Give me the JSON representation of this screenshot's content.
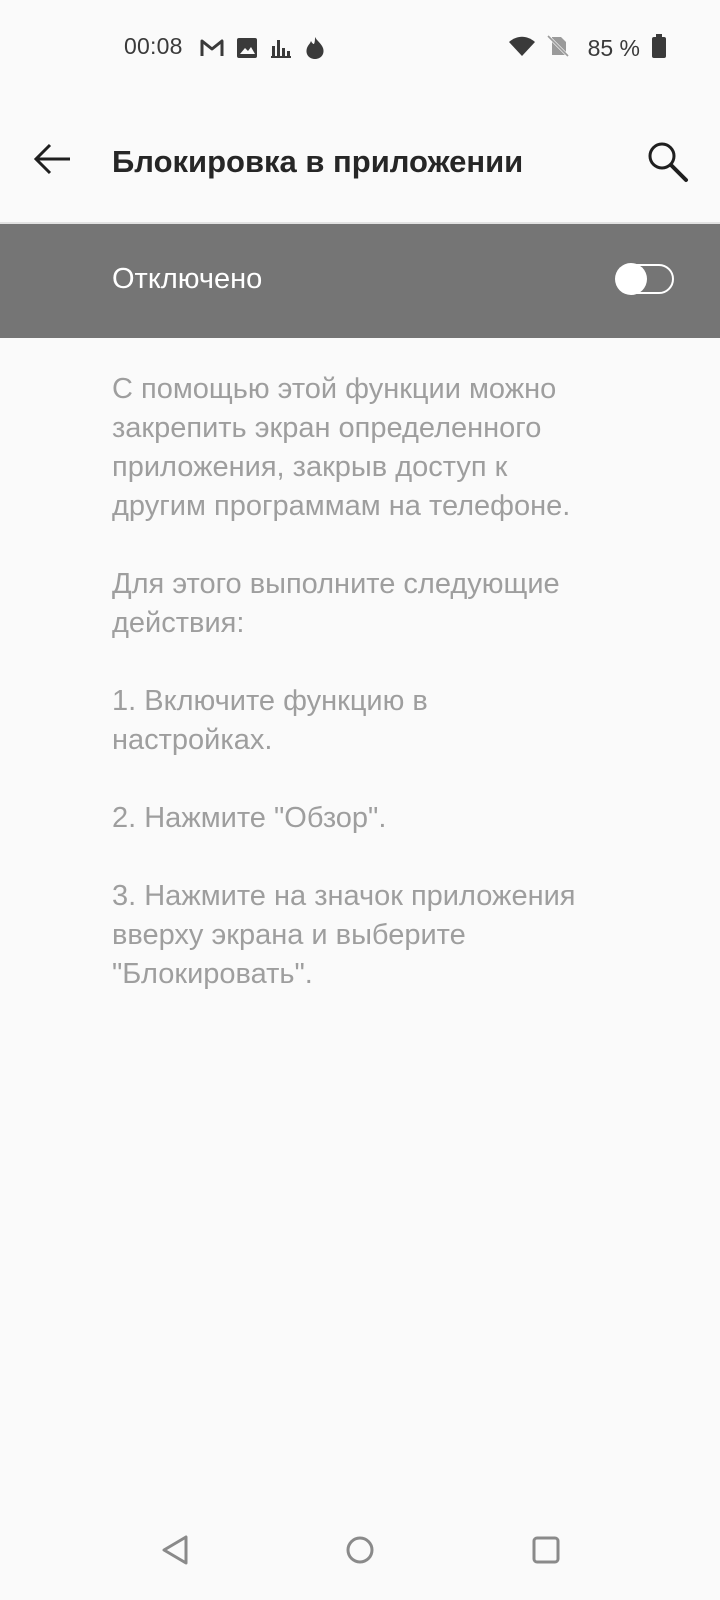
{
  "status_bar": {
    "time": "00:08",
    "battery_text": "85 %",
    "icons_left": [
      "gmail-icon",
      "image-icon",
      "bar-chart-icon",
      "fire-icon"
    ],
    "icons_right": [
      "wifi-icon",
      "no-sim-icon",
      "battery-icon"
    ]
  },
  "app_bar": {
    "title": "Блокировка в приложении",
    "back_icon": "arrow-left-icon",
    "search_icon": "search-icon"
  },
  "toggle": {
    "label": "Отключено",
    "state": "off"
  },
  "description": {
    "paragraphs": [
      "С помощью этой функции можно закрепить экран определенного приложения, закрыв доступ к другим программам на телефоне.",
      "Для этого выполните следующие действия:",
      "1. Включите функцию в настройках.",
      "2. Нажмите \"Обзор\".",
      "3. Нажмите на значок приложения вверху экрана и выберите \"Блокировать\"."
    ]
  },
  "nav_bar": {
    "icons": [
      "nav-back-icon",
      "nav-home-icon",
      "nav-recents-icon"
    ]
  },
  "colors": {
    "background": "#fafafa",
    "toggle_row": "#757575",
    "description_text": "#9e9e9e",
    "title_text": "#262626"
  }
}
